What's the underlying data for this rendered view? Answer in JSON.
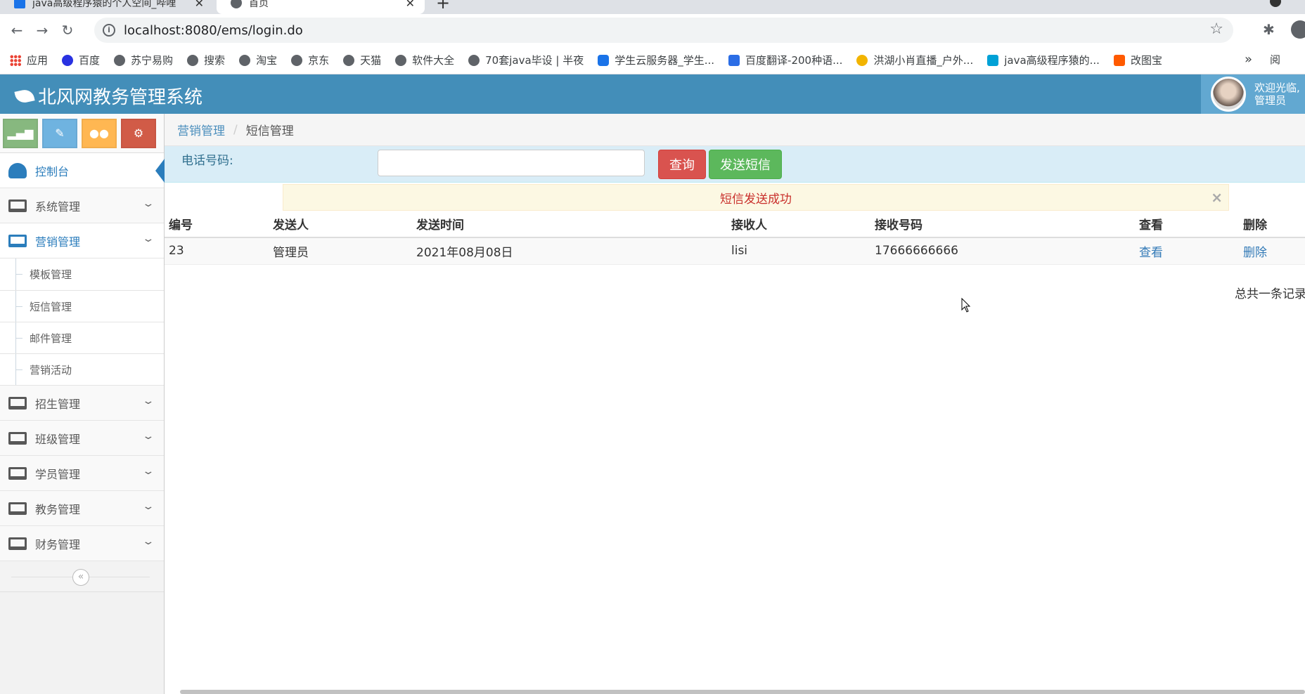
{
  "browser": {
    "tabs": [
      {
        "title": "java高级程序猿的个人空间_哔哩",
        "active": false
      },
      {
        "title": "首页",
        "active": true
      }
    ],
    "url": "localhost:8080/ems/login.do",
    "bookmarks": [
      {
        "label": "应用",
        "icon": "apps-grid-icon"
      },
      {
        "label": "百度",
        "icon": "paw-icon"
      },
      {
        "label": "苏宁易购",
        "icon": "globe-icon"
      },
      {
        "label": "搜索",
        "icon": "globe-icon"
      },
      {
        "label": "淘宝",
        "icon": "globe-icon"
      },
      {
        "label": "京东",
        "icon": "globe-icon"
      },
      {
        "label": "天猫",
        "icon": "globe-icon"
      },
      {
        "label": "软件大全",
        "icon": "globe-icon"
      },
      {
        "label": "70套java毕设 | 半夜",
        "icon": "globe-icon"
      },
      {
        "label": "学生云服务器_学生...",
        "icon": "cloud-icon"
      },
      {
        "label": "百度翻译-200种语...",
        "icon": "translate-icon"
      },
      {
        "label": "洪湖小肖直播_户外...",
        "icon": "bird-icon"
      },
      {
        "label": "java高级程序猿的...",
        "icon": "tv-icon"
      },
      {
        "label": "改图宝",
        "icon": "image-icon"
      }
    ],
    "more_label": "»",
    "reader_label": "阅"
  },
  "header": {
    "title": "北风网教务管理系统",
    "welcome_line1": "欢迎光临,",
    "welcome_line2": "管理员"
  },
  "sidebar": {
    "dashboard": "控制台",
    "menus": [
      {
        "label": "系统管理",
        "open": false
      },
      {
        "label": "营销管理",
        "open": true,
        "children": [
          "模板管理",
          "短信管理",
          "邮件管理",
          "营销活动"
        ]
      },
      {
        "label": "招生管理",
        "open": false
      },
      {
        "label": "班级管理",
        "open": false
      },
      {
        "label": "学员管理",
        "open": false
      },
      {
        "label": "教务管理",
        "open": false
      },
      {
        "label": "财务管理",
        "open": false
      }
    ],
    "collapse_symbol": "«"
  },
  "breadcrumb": {
    "parent": "营销管理",
    "current": "短信管理"
  },
  "search": {
    "label": "电话号码:",
    "value": "",
    "query_button": "查询",
    "send_button": "发送短信"
  },
  "alert": {
    "message": "短信发送成功",
    "close": "×"
  },
  "table": {
    "headers": [
      "编号",
      "发送人",
      "发送时间",
      "接收人",
      "接收号码",
      "查看",
      "删除"
    ],
    "rows": [
      [
        "23",
        "管理员",
        "2021年08月08日",
        "lisi",
        "17666666666",
        "查看",
        "删除"
      ]
    ]
  },
  "footer": {
    "count_text": "总共一条记录"
  },
  "colors": {
    "header": "#438eb9",
    "primary": "#2b7dbc",
    "danger": "#d9534f",
    "success": "#5cb85c",
    "info_bg": "#d9edf7",
    "warning_bg": "#fcf8e3"
  }
}
